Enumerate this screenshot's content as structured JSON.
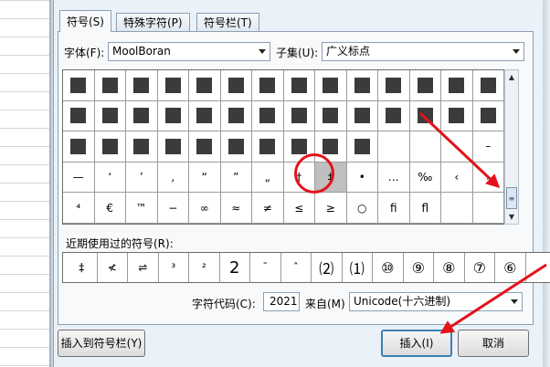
{
  "tabs": [
    {
      "label": "符号(S)"
    },
    {
      "label": "特殊字符(P)"
    },
    {
      "label": "符号栏(T)"
    }
  ],
  "font": {
    "label": "字体(F):",
    "value": "MoolBoran"
  },
  "subset": {
    "label": "子集(U):",
    "value": "广义标点"
  },
  "grid_rows": [
    [
      "",
      "",
      "",
      "",
      "",
      "",
      "",
      "",
      "",
      "",
      "",
      "",
      "",
      ""
    ],
    [
      "",
      "",
      "",
      "",
      "",
      "",
      "",
      "",
      "",
      "",
      "",
      "",
      "",
      ""
    ],
    [
      "",
      "",
      "",
      "",
      "",
      "",
      "",
      "",
      "",
      "",
      "",
      "",
      "",
      "–"
    ],
    [
      "—",
      "ʻ",
      "’",
      ",",
      "“",
      "”",
      "„",
      "†",
      "‡",
      "•",
      "…",
      "‰",
      "‹",
      "›"
    ],
    [
      "⁴",
      "€",
      "™",
      "−",
      "∞",
      "≈",
      "≠",
      "≤",
      "≥",
      "○",
      "ﬁ",
      "ﬂ",
      "",
      ""
    ]
  ],
  "grid_blocks": [
    [
      true,
      true,
      true,
      true,
      true,
      true,
      true,
      true,
      true,
      true,
      true,
      true,
      true,
      true
    ],
    [
      true,
      true,
      true,
      true,
      true,
      true,
      true,
      true,
      true,
      true,
      true,
      true,
      true,
      true
    ],
    [
      true,
      true,
      true,
      true,
      true,
      true,
      true,
      true,
      true,
      true,
      false,
      false,
      false,
      false
    ],
    [
      false,
      false,
      false,
      false,
      false,
      false,
      false,
      false,
      false,
      false,
      false,
      false,
      false,
      false
    ],
    [
      false,
      false,
      false,
      false,
      false,
      false,
      false,
      false,
      false,
      false,
      false,
      false,
      false,
      false
    ]
  ],
  "recent": {
    "label": "近期使用过的符号(R):",
    "symbols": [
      "‡",
      "≮",
      "⇌",
      "³",
      "²",
      "2",
      "¯",
      "ˆ",
      "⑵",
      "⑴",
      "⑩",
      "⑨",
      "⑧",
      "⑦",
      "⑥"
    ]
  },
  "char_code": {
    "label": "字符代码(C):",
    "value": "2021"
  },
  "from": {
    "label": "来自(M)",
    "value": "Unicode(十六进制)"
  },
  "buttons": {
    "insert_to_bar": "插入到符号栏(Y)",
    "insert": "插入(I)",
    "cancel": "取消"
  },
  "scrollbar": {
    "up": "▲",
    "down": "▼",
    "thumb": "≡"
  },
  "colors": {
    "annotation_red": "#e3121b",
    "selected_cell": "#bfbfbf"
  }
}
